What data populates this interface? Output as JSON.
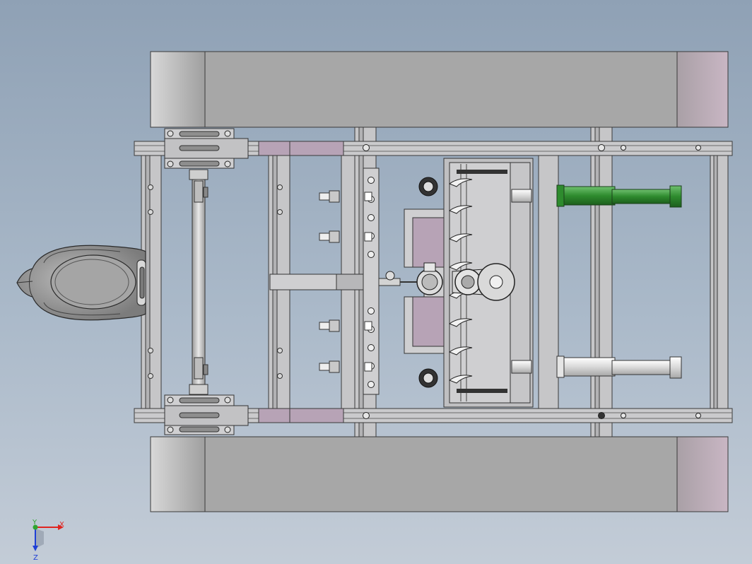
{
  "window": {
    "title": ""
  },
  "triad": {
    "x_label": "X",
    "y_label": "Y",
    "z_label": "Z",
    "x_color": "#e0241f",
    "y_color": "#2fa52f",
    "z_color": "#1f3fd6"
  },
  "colors": {
    "frame_fill": "#c9c9cb",
    "frame_stroke": "#3a3a3a",
    "track_fill": "#a9a9a9",
    "track_end": "#b9a9b3",
    "hydraulic_cylinder": "#2e8b2e",
    "plate_highlight": "#b7a3b6"
  },
  "icons": [
    "coordinate-triad-icon"
  ]
}
